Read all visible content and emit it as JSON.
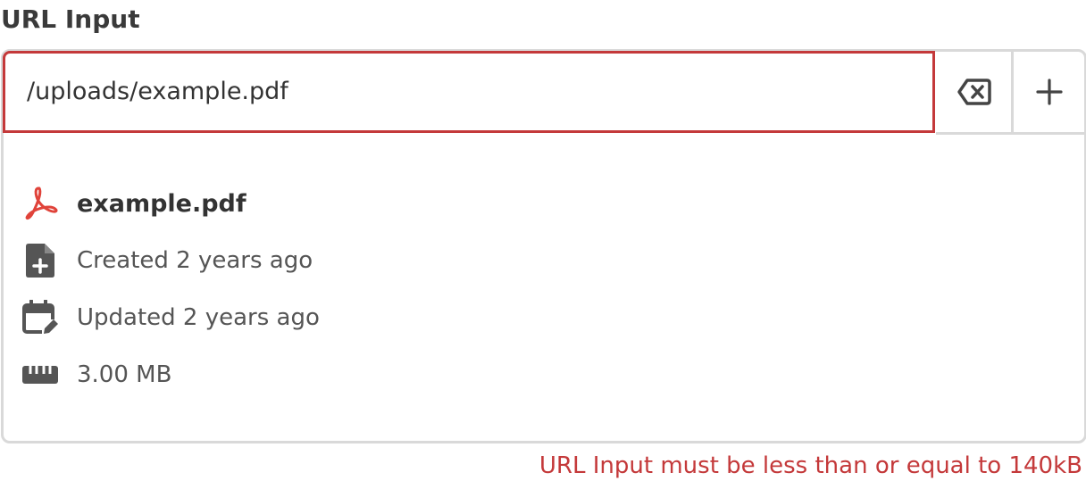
{
  "field": {
    "label": "URL Input",
    "value": "/uploads/example.pdf"
  },
  "actions": {
    "clear_icon": "backspace-icon",
    "add_icon": "plus-icon"
  },
  "file": {
    "name": "example.pdf",
    "type_icon": "pdf-icon",
    "created": "Created 2 years ago",
    "updated": "Updated 2 years ago",
    "size": "3.00 MB"
  },
  "error": {
    "message": "URL Input must be less than or equal to 140kB"
  },
  "colors": {
    "error": "#c4393a",
    "border": "#d9d9d9",
    "pdf": "#e0433a",
    "icon": "#555555"
  }
}
